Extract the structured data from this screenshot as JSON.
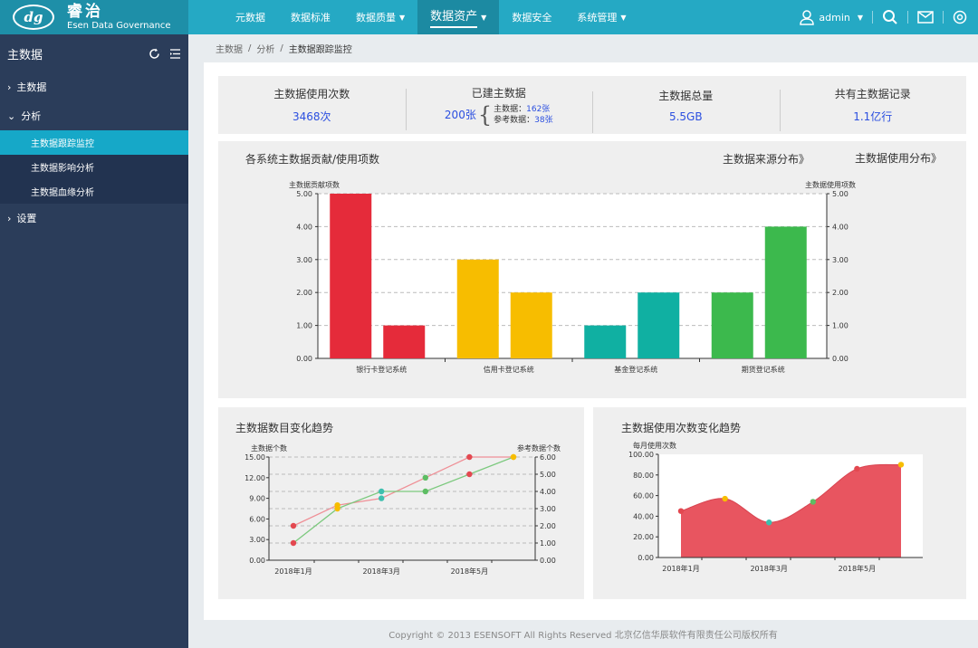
{
  "app": {
    "name_cn": "睿治",
    "name_en": "Esen Data Governance",
    "logo_mark": "dg"
  },
  "nav": {
    "items": [
      {
        "label": "元数据",
        "dropdown": false,
        "active": false
      },
      {
        "label": "数据标准",
        "dropdown": false,
        "active": false
      },
      {
        "label": "数据质量",
        "dropdown": true,
        "active": false
      },
      {
        "label": "数据资产",
        "dropdown": true,
        "active": true
      },
      {
        "label": "数据安全",
        "dropdown": false,
        "active": false
      },
      {
        "label": "系统管理",
        "dropdown": true,
        "active": false
      }
    ]
  },
  "user": {
    "name": "admin"
  },
  "sidebar": {
    "title": "主数据",
    "items": [
      {
        "label": "主数据",
        "marker": "›"
      },
      {
        "label": "分析",
        "marker": "⌄"
      },
      {
        "label": "主数据跟踪监控"
      },
      {
        "label": "主数据影响分析"
      },
      {
        "label": "主数据血缘分析"
      },
      {
        "label": "设置",
        "marker": "›"
      }
    ]
  },
  "breadcrumb": {
    "items": [
      "主数据",
      "分析",
      "主数据跟踪监控"
    ],
    "separator": "/"
  },
  "stats": {
    "usage_label": "主数据使用次数",
    "usage_value": "3468次",
    "built_label": "已建主数据",
    "built_value": "200张",
    "built_master_label": "主数据：",
    "built_master_value": "162张",
    "built_ref_label": "参考数据：",
    "built_ref_value": "38张",
    "total_label": "主数据总量",
    "total_value": "5.5GB",
    "records_label": "共有主数据记录",
    "records_value": "1.1亿行"
  },
  "bar_panel": {
    "title": "各系统主数据贡献/使用项数",
    "link1": "主数据来源分布》",
    "link2": "主数据使用分布》"
  },
  "trend_panel": {
    "title": "主数据数目变化趋势"
  },
  "usage_panel": {
    "title": "主数据使用次数变化趋势"
  },
  "footer": {
    "text": "Copyright © 2013 ESENSOFT All Rights Reserved 北京亿信华辰软件有限责任公司版权所有"
  },
  "chart_data": [
    {
      "type": "bar",
      "categories": [
        "银行卡登记系统",
        "信用卡登记系统",
        "基金登记系统",
        "期货登记系统"
      ],
      "ylabel": "主数据贡献项数",
      "y2label": "主数据使用项数",
      "ylim": [
        0,
        5
      ],
      "y2lim": [
        0,
        5
      ],
      "yticks": [
        "0.00",
        "1.00",
        "2.00",
        "3.00",
        "4.00",
        "5.00"
      ],
      "grid": true,
      "series": [
        {
          "values": [
            5,
            3,
            1,
            2
          ]
        },
        {
          "values": [
            1,
            2,
            2,
            4
          ]
        }
      ],
      "colors": [
        "#e52b3a",
        "#f7bd00",
        "#10b0a2",
        "#3cb94d"
      ]
    },
    {
      "type": "line",
      "x": [
        "2018年1月",
        "2018年2月",
        "2018年3月",
        "2018年4月",
        "2018年5月",
        "2018年6月"
      ],
      "xticks": [
        "2018年1月",
        "2018年3月",
        "2018年5月"
      ],
      "ylabel": "主数据个数",
      "y2label": "参考数据个数",
      "ylim": [
        0,
        15
      ],
      "y2lim": [
        0,
        6
      ],
      "yticks": [
        "0.00",
        "3.00",
        "6.00",
        "9.00",
        "12.00",
        "15.00"
      ],
      "y2ticks": [
        "0.00",
        "1.00",
        "2.00",
        "3.00",
        "4.00",
        "5.00",
        "6.00"
      ],
      "grid": true,
      "series": [
        {
          "axis": "left",
          "values": [
            5,
            8,
            9,
            12,
            15,
            15
          ],
          "color": "#ef8f96"
        },
        {
          "axis": "right",
          "values": [
            1,
            3,
            4,
            4,
            5,
            6
          ],
          "color": "#7cc97e"
        }
      ],
      "point_colors": [
        "#e34850",
        "#f7bd00",
        "#3ebfae",
        "#5dbd63",
        "#e34850",
        "#f7bd00"
      ]
    },
    {
      "type": "area",
      "x": [
        "2018年1月",
        "2018年2月",
        "2018年3月",
        "2018年4月",
        "2018年5月",
        "2018年6月"
      ],
      "xticks": [
        "2018年1月",
        "2018年3月",
        "2018年5月"
      ],
      "ylabel": "每月使用次数",
      "ylim": [
        0,
        100
      ],
      "yticks": [
        "0.00",
        "20.00",
        "40.00",
        "60.00",
        "80.00",
        "100.00"
      ],
      "values": [
        45,
        57,
        34,
        54,
        86,
        90
      ],
      "fill_color": "#e85560",
      "point_colors": [
        "#e34850",
        "#f7bd00",
        "#3ebfae",
        "#5dbd63",
        "#e34850",
        "#f7bd00"
      ]
    }
  ]
}
